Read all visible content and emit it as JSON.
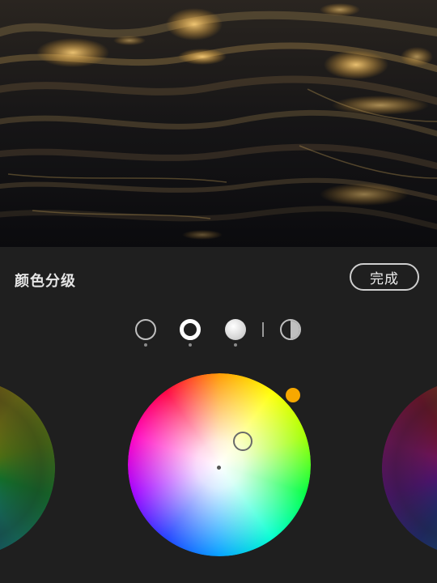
{
  "panel": {
    "title": "颜色分级",
    "done_label": "完成"
  },
  "modes": [
    {
      "name": "shadows",
      "icon": "shadows-ring-icon",
      "selected": false
    },
    {
      "name": "midtones",
      "icon": "midtones-ring-icon",
      "selected": true
    },
    {
      "name": "highlights",
      "icon": "highlights-circle-icon",
      "selected": false
    },
    {
      "name": "global",
      "icon": "half-circle-icon",
      "selected": false
    }
  ],
  "colors": {
    "accent": "#f7a800",
    "background": "#1f1f1f"
  }
}
